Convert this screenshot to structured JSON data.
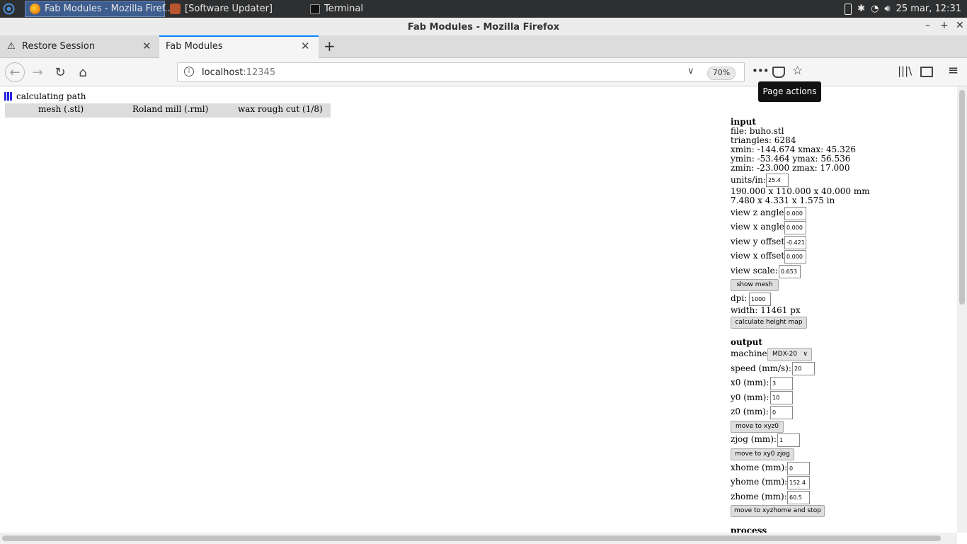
{
  "taskbar": {
    "tasks": [
      {
        "label": "Fab Modules - Mozilla Firef..."
      },
      {
        "label": "[Software Updater]"
      },
      {
        "label": "Terminal"
      }
    ],
    "clock": "25 mar, 12:31"
  },
  "window": {
    "title": "Fab Modules - Mozilla Firefox"
  },
  "tabs": [
    {
      "label": "Restore Session",
      "active": false
    },
    {
      "label": "Fab Modules",
      "active": true
    }
  ],
  "nav": {
    "url_host": "localhost",
    "url_port": ":12345",
    "zoom": "70%",
    "tooltip": "Page actions"
  },
  "page": {
    "status": "calculating path",
    "modules": [
      "mesh (.stl)",
      "Roland mill (.rml)",
      "wax rough cut (1/8)"
    ],
    "input": {
      "heading": "input",
      "file": "file: buho.stl",
      "triangles": "triangles: 6284",
      "xrange": "xmin: -144.674 xmax: 45.326",
      "yrange": "ymin: -53.464 ymax: 56.536",
      "zrange": "zmin: -23.000 zmax: 17.000",
      "units_label": "units/in:",
      "units_value": "25.4",
      "dims_mm": "190.000 x 110.000 x 40.000 mm",
      "dims_in": "7.480 x 4.331 x 1.575 in",
      "view_z_angle_label": "view z angle:",
      "view_z_angle": "0.000",
      "view_x_angle_label": "view x angle:",
      "view_x_angle": "0.000",
      "view_y_offset_label": "view y offset:",
      "view_y_offset": "-0.421",
      "view_x_offset_label": "view x offset:",
      "view_x_offset": "0.000",
      "view_scale_label": "view scale:",
      "view_scale": "0.653",
      "show_mesh": "show mesh",
      "dpi_label": "dpi:",
      "dpi": "1000",
      "width": "width: 11461 px",
      "calc_height_map": "calculate height map"
    },
    "output": {
      "heading": "output",
      "machine_label": "machine",
      "machine": "MDX-20",
      "speed_label": "speed (mm/s):",
      "speed": "20",
      "x0_label": "x0 (mm):",
      "x0": "3",
      "y0_label": "y0 (mm):",
      "y0": "10",
      "z0_label": "z0 (mm):",
      "z0": "0",
      "move_xyz0": "move to xyz0",
      "zjog_label": "zjog (mm):",
      "zjog": "1",
      "move_xy0_zjog": "move to xy0 zjog",
      "xhome_label": "xhome (mm):",
      "xhome": "0",
      "yhome_label": "yhome (mm):",
      "yhome": "152.4",
      "zhome_label": "zhome (mm):",
      "zhome": "60.5",
      "move_xyzhome": "move to xyzhome and stop"
    },
    "process_heading": "process"
  }
}
